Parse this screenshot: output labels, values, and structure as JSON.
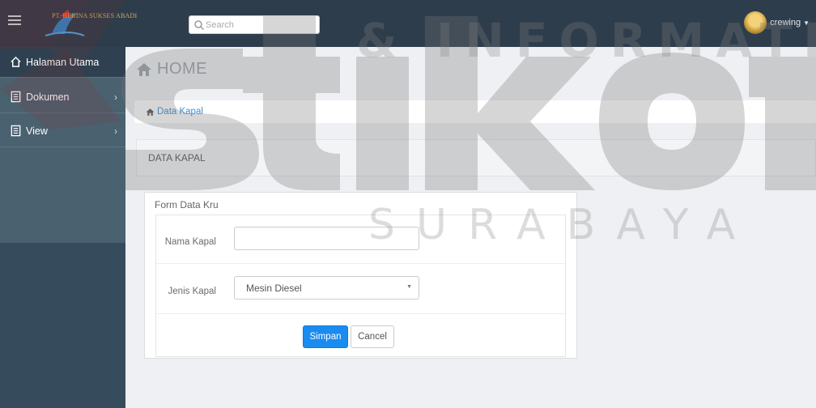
{
  "topbar": {
    "logo_text": "PT. BERINA SUKSES ABADI",
    "search_placeholder": "Search",
    "user_name": "crewing",
    "icons": {
      "menu": "hamburger-icon",
      "search": "search-icon",
      "caret": "caret-down-icon"
    }
  },
  "sidebar": {
    "items": [
      {
        "label": "Halaman Utama",
        "icon": "home-icon"
      },
      {
        "label": "Dokumen",
        "icon": "document-icon"
      },
      {
        "label": "View",
        "icon": "document-icon"
      }
    ]
  },
  "main": {
    "page_title": "HOME",
    "breadcrumb": "Data Kapal",
    "panel_title": "DATA KAPAL",
    "form": {
      "title": "Form Data Kru",
      "nama_kapal_label": "Nama Kapal",
      "nama_kapal_value": "",
      "jenis_kapal_label": "Jenis Kapal",
      "jenis_kapal_value": "Mesin Diesel",
      "save_label": "Simpan",
      "cancel_label": "Cancel"
    }
  },
  "watermark": {
    "line1": "& INFORMATIKA",
    "line2": "SURABAYA"
  },
  "colors": {
    "topbar": "#2e3d4c",
    "sidebar": "#364c5c",
    "primary_button": "#1a8cf0",
    "link": "#3a8cd6"
  }
}
